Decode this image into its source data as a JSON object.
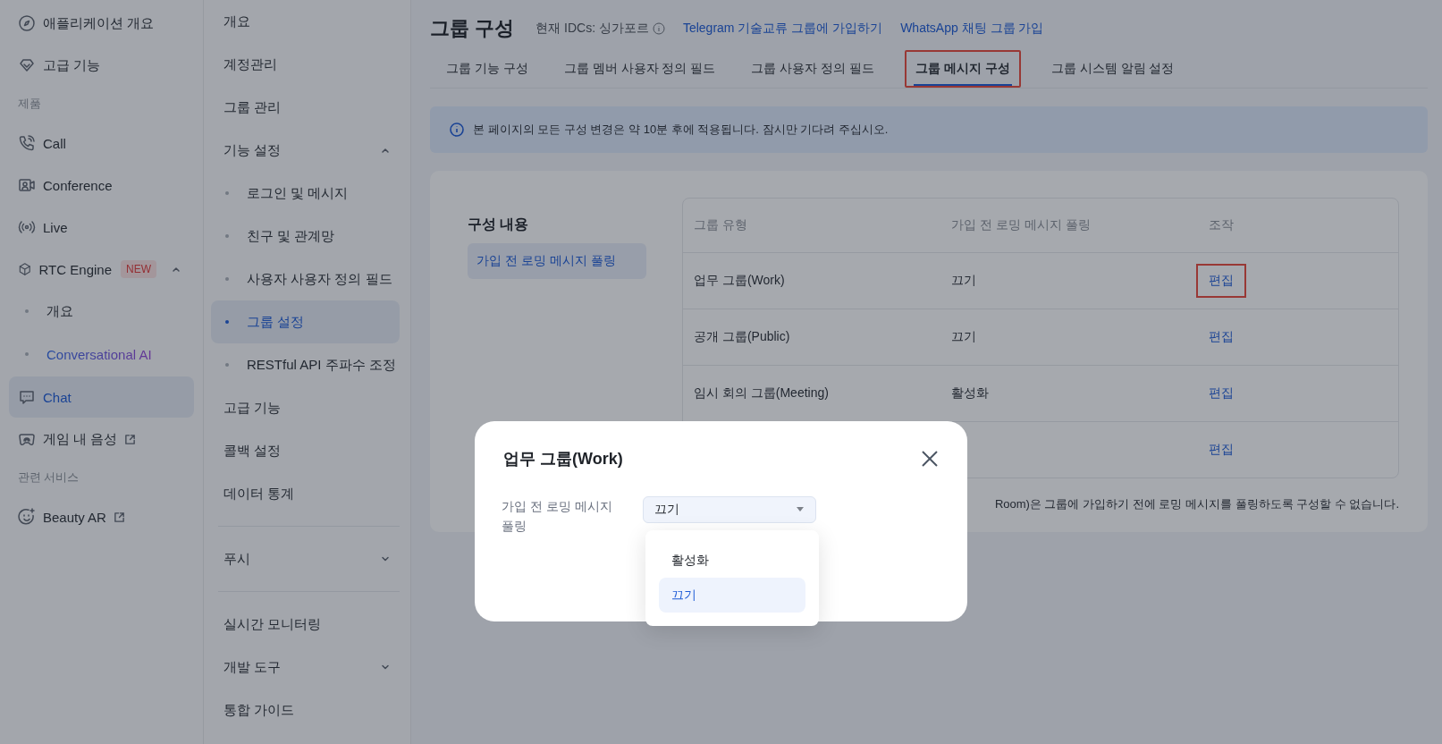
{
  "nav": {
    "items": [
      {
        "kind": "item",
        "label": "애플리케이션 개요",
        "selected": false,
        "external": false
      },
      {
        "kind": "item",
        "label": "고급 기능",
        "selected": false,
        "external": false
      },
      {
        "kind": "section",
        "label": "제품"
      },
      {
        "kind": "item",
        "label": "Call",
        "selected": false,
        "external": false
      },
      {
        "kind": "item",
        "label": "Conference",
        "selected": false,
        "external": false
      },
      {
        "kind": "item",
        "label": "Live",
        "selected": false,
        "external": false
      },
      {
        "kind": "item",
        "label": "RTC Engine",
        "badge": "NEW",
        "expanded": true,
        "selected": false,
        "external": false
      },
      {
        "kind": "sub",
        "label": "개요",
        "selected": false
      },
      {
        "kind": "accent-sub",
        "label": "Conversational AI",
        "selected": false
      },
      {
        "kind": "item",
        "label": "Chat",
        "selected": true,
        "external": false
      },
      {
        "kind": "item",
        "label": "게임 내 음성",
        "selected": false,
        "external": true
      },
      {
        "kind": "section",
        "label": "관련 서비스"
      },
      {
        "kind": "item",
        "label": "Beauty AR",
        "selected": false,
        "external": true
      }
    ]
  },
  "subnav": {
    "items": [
      {
        "kind": "item",
        "label": "개요",
        "selected": false
      },
      {
        "kind": "item",
        "label": "계정관리",
        "selected": false
      },
      {
        "kind": "item",
        "label": "그룹 관리",
        "selected": false
      },
      {
        "kind": "group",
        "label": "기능 설정",
        "expanded": true,
        "children": [
          {
            "label": "로그인 및 메시지",
            "selected": false
          },
          {
            "label": "친구 및 관계망",
            "selected": false
          },
          {
            "label": "사용자 사용자 정의 필드",
            "selected": false
          },
          {
            "label": "그룹 설정",
            "selected": true
          },
          {
            "label": "RESTful API 주파수 조정",
            "selected": false
          }
        ]
      },
      {
        "kind": "item",
        "label": "고급 기능",
        "selected": false
      },
      {
        "kind": "item",
        "label": "콜백 설정",
        "selected": false
      },
      {
        "kind": "item",
        "label": "데이터 통계",
        "selected": false
      },
      {
        "kind": "divider"
      },
      {
        "kind": "group",
        "label": "푸시",
        "expanded": false
      },
      {
        "kind": "divider"
      },
      {
        "kind": "item",
        "label": "실시간 모니터링",
        "selected": false
      },
      {
        "kind": "group",
        "label": "개발 도구",
        "expanded": false
      },
      {
        "kind": "item",
        "label": "통합 가이드",
        "selected": false
      }
    ]
  },
  "header": {
    "title": "그룹 구성",
    "idc": "현재 IDCs: 싱가포르",
    "links": [
      "Telegram 기술교류 그룹에 가입하기",
      "WhatsApp 채팅 그룹 가입"
    ]
  },
  "tabs": [
    {
      "label": "그룹 기능 구성",
      "selected": false,
      "annotated": false
    },
    {
      "label": "그룹 멤버 사용자 정의 필드",
      "selected": false,
      "annotated": false
    },
    {
      "label": "그룹 사용자 정의 필드",
      "selected": false,
      "annotated": false
    },
    {
      "label": "그룹 메시지 구성",
      "selected": true,
      "annotated": true
    },
    {
      "label": "그룹 시스템 알림 설정",
      "selected": false,
      "annotated": false
    }
  ],
  "alert": "본 페이지의 모든 구성 변경은 약 10분 후에 적용됩니다. 잠시만 기다려 주십시오.",
  "config": {
    "title": "구성 내용",
    "items": [
      {
        "label": "가입 전 로밍 메시지 풀링",
        "selected": true
      }
    ]
  },
  "table": {
    "columns": [
      "그룹 유형",
      "가입 전 로밍 메시지 풀링",
      "조작"
    ],
    "rows": [
      {
        "type": "업무 그룹(Work)",
        "value": "끄기",
        "action": "편집",
        "annotated": true
      },
      {
        "type": "공개 그룹(Public)",
        "value": "끄기",
        "action": "편집",
        "annotated": false
      },
      {
        "type": "임시 회의 그룹(Meeting)",
        "value": "활성화",
        "action": "편집",
        "annotated": false
      },
      {
        "action": "편집",
        "annotated": false
      }
    ]
  },
  "note": "Room)은 그룹에 가입하기 전에 로밍 메시지를 풀링하도록 구성할 수 없습니다.",
  "modal": {
    "title": "업무 그룹(Work)",
    "field_label": "가입 전 로밍 메시지 풀링",
    "value": "끄기",
    "options": [
      {
        "label": "활성화",
        "selected": false
      },
      {
        "label": "끄기",
        "selected": true
      }
    ]
  }
}
